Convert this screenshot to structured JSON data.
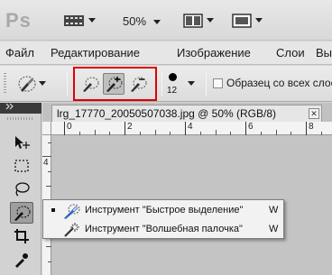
{
  "app": {
    "logo": "Ps",
    "zoom": "50%"
  },
  "menu": [
    "Файл",
    "Редактирование",
    "Изображение",
    "Слои",
    "Вы"
  ],
  "options": {
    "brush_size": "12",
    "sample_all_label": "Образец со всех слоё"
  },
  "document": {
    "tab_title": "lrg_17770_20050507038.jpg @ 50% (RGB/8)",
    "close_glyph": "✕",
    "ruler_top": [
      "0",
      "2",
      "4",
      "6",
      "8"
    ],
    "ruler_left": [
      "4"
    ]
  },
  "flyout": {
    "items": [
      {
        "label": "Инструмент \"Быстрое выделение\"",
        "key": "W",
        "active": true
      },
      {
        "label": "Инструмент \"Волшебная палочка\"",
        "key": "W",
        "active": false
      }
    ]
  },
  "colors": {
    "highlight": "#e00000",
    "panel": "#d2d2d2",
    "menu_bg": "#f2f2f2",
    "brush_blue": "#2c66c4"
  },
  "icons": [
    "move-tool-icon",
    "marquee-tool-icon",
    "lasso-tool-icon",
    "quick-selection-tool-icon",
    "crop-tool-icon",
    "eyedropper-tool-icon",
    "magic-wand-icon"
  ]
}
